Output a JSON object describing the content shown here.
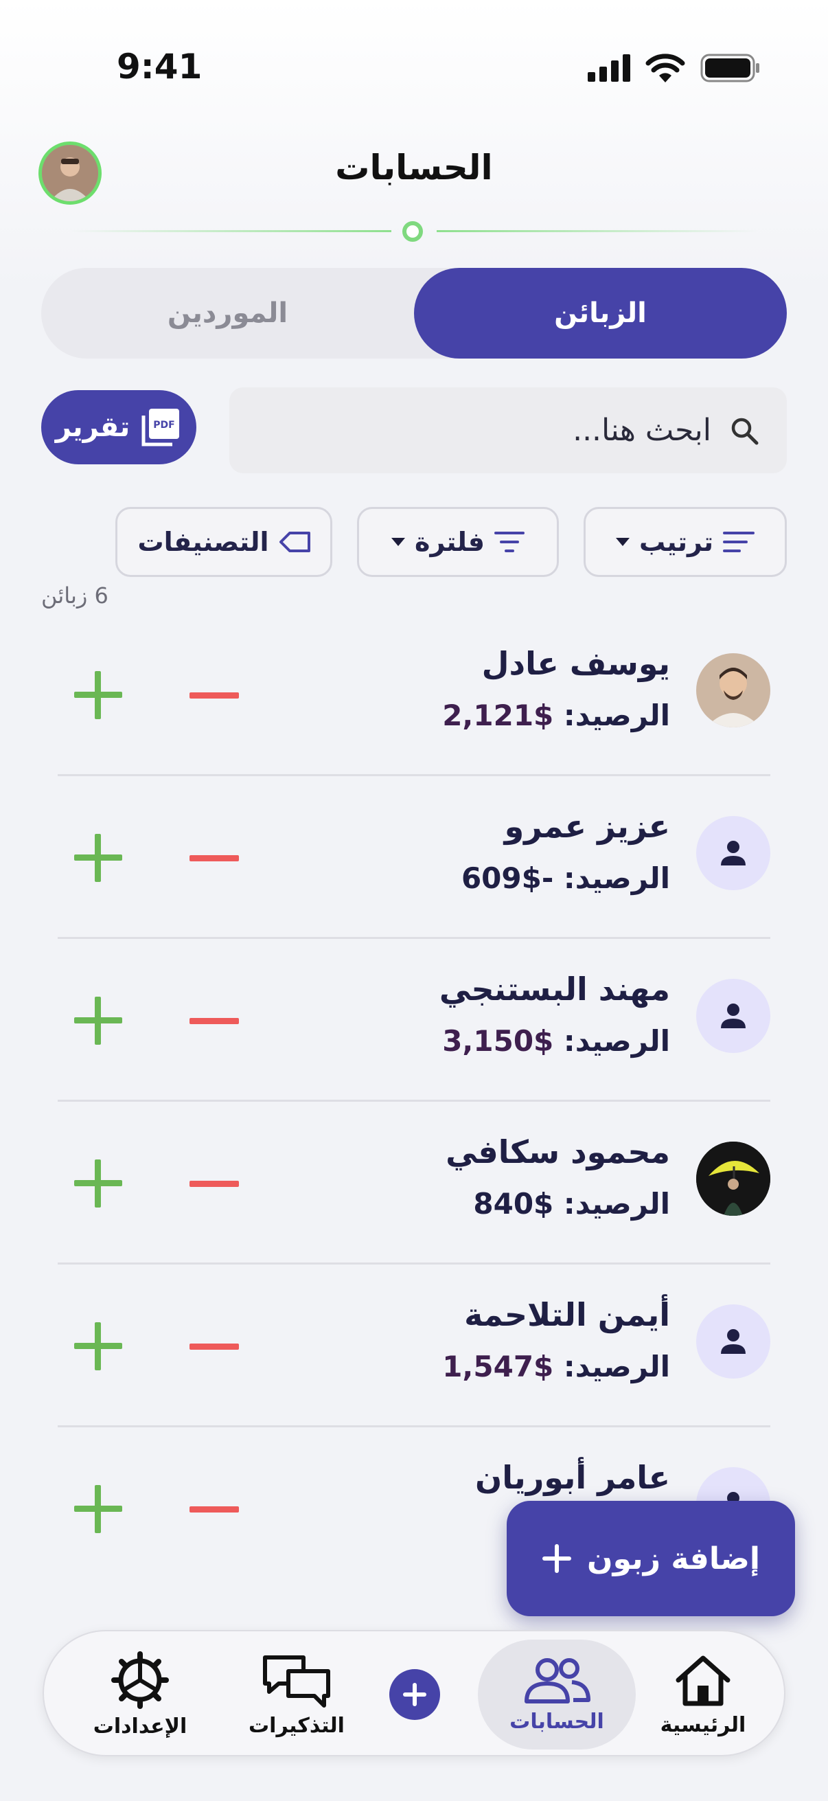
{
  "status_bar": {
    "time": "9:41"
  },
  "header": {
    "title": "الحسابات"
  },
  "segmented": {
    "customers_label": "الزبائن",
    "suppliers_label": "الموردين",
    "selected": "الزبائن"
  },
  "search": {
    "placeholder": "ابحث هنا..."
  },
  "report_button": {
    "label": "تقرير",
    "icon_text": "PDF"
  },
  "chips": {
    "sort_label": "ترتيب",
    "filter_label": "فلترة",
    "categories_label": "التصنيفات"
  },
  "count_label": "6 زبائن",
  "accounts": [
    {
      "name": "يوسف عادل",
      "balance_label": "الرصيد:",
      "balance": "$2,121",
      "avatar": "photo-man-icon"
    },
    {
      "name": "عزيز عمرو",
      "balance_label": "الرصيد:",
      "balance": "-$609",
      "avatar": "person-icon"
    },
    {
      "name": "مهند البستنجي",
      "balance_label": "الرصيد:",
      "balance": "$3,150",
      "avatar": "person-icon"
    },
    {
      "name": "محمود سكافي",
      "balance_label": "الرصيد:",
      "balance": "$840",
      "avatar": "photo-umbrella-icon"
    },
    {
      "name": "أيمن التلاحمة",
      "balance_label": "الرصيد:",
      "balance": "$1,547",
      "avatar": "person-icon"
    },
    {
      "name": "عامر أبوريان",
      "balance_label": "",
      "balance": "",
      "avatar": "person-icon"
    }
  ],
  "fab": {
    "label": "إضافة زبون"
  },
  "tabbar": {
    "home": "الرئيسية",
    "accounts": "الحسابات",
    "reminders": "التذكيرات",
    "settings": "الإعدادات"
  },
  "colors": {
    "primary": "#4643a8",
    "plus": "#6ab754",
    "minus": "#ee5a5a",
    "accent_green": "#7fd97f"
  }
}
